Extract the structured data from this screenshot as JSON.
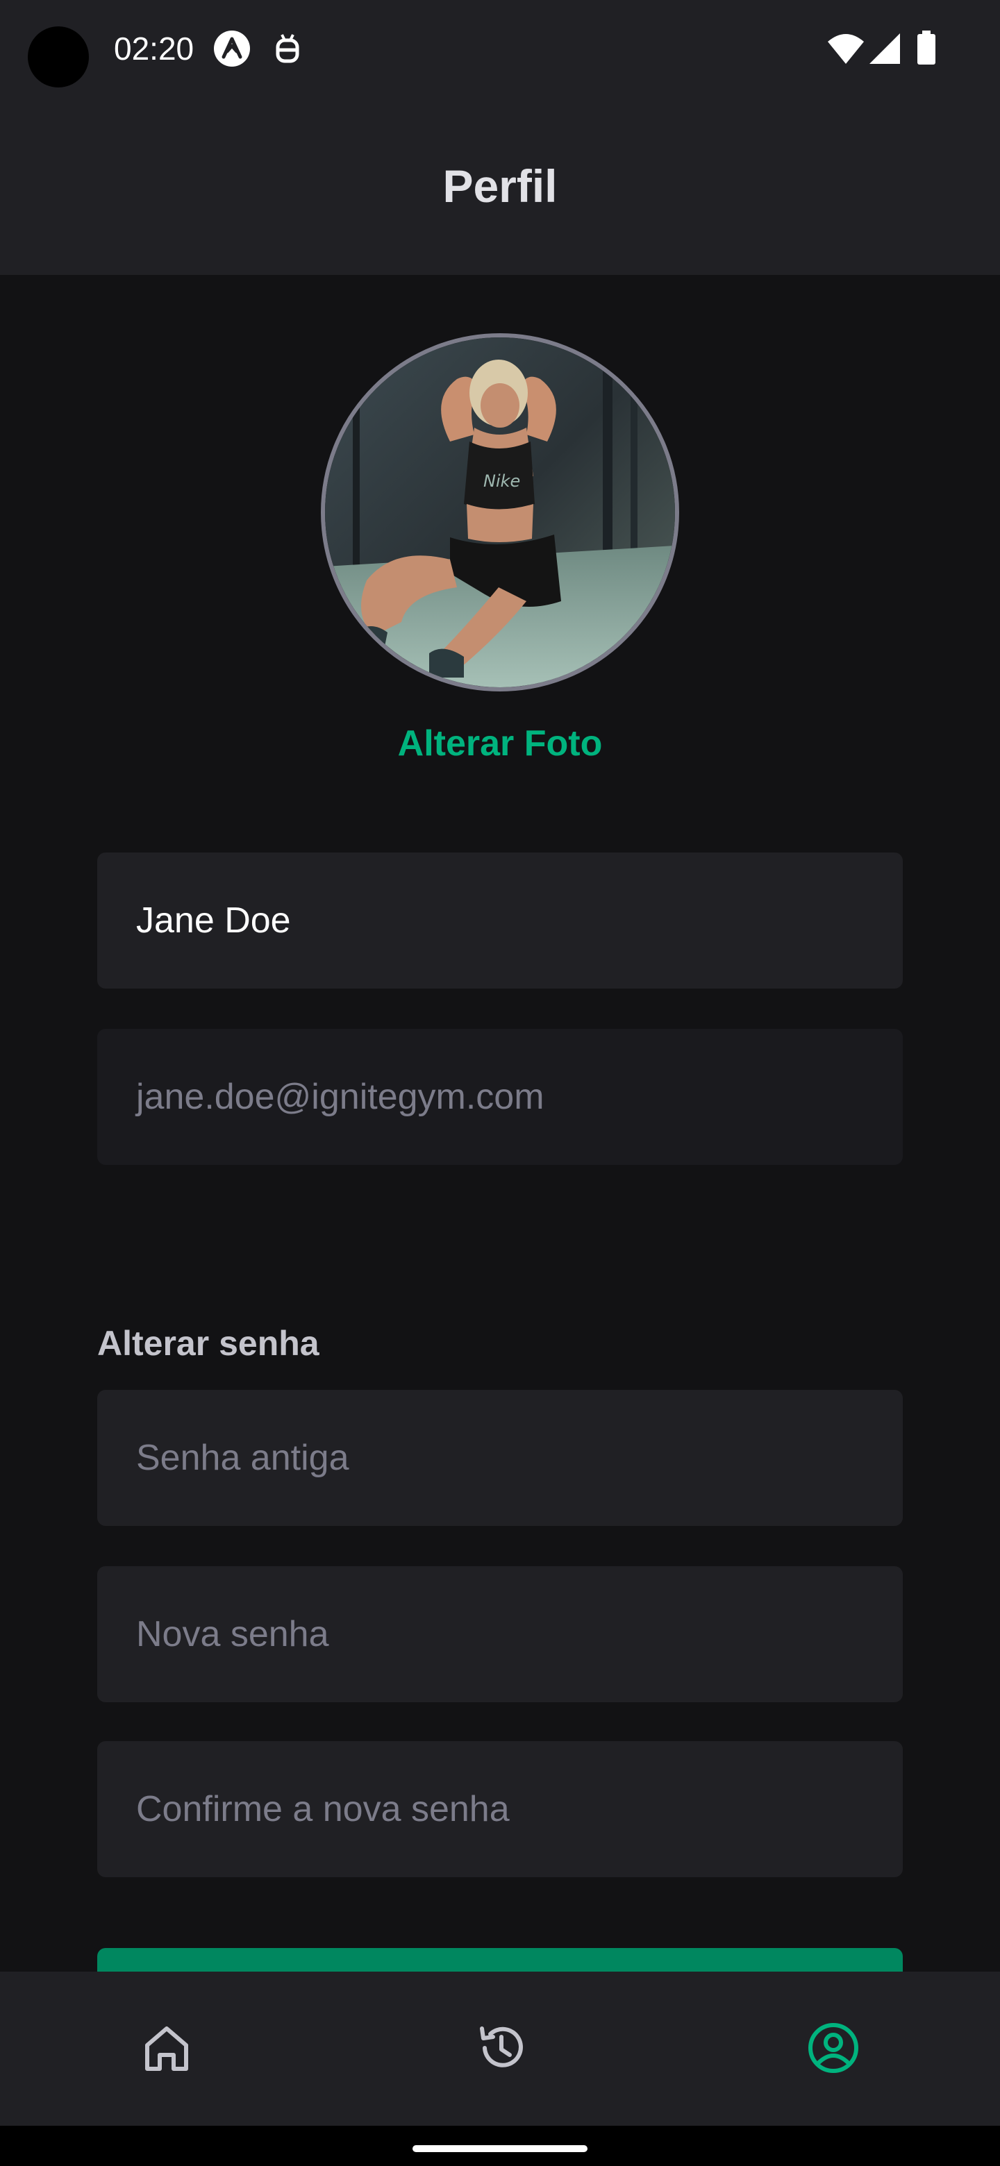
{
  "status_bar": {
    "time": "02:20"
  },
  "header": {
    "title": "Perfil"
  },
  "profile": {
    "change_photo_label": "Alterar Foto",
    "name_value": "Jane Doe",
    "email_value": "jane.doe@ignitegym.com"
  },
  "password_section": {
    "title": "Alterar senha",
    "old_password_placeholder": "Senha antiga",
    "new_password_placeholder": "Nova senha",
    "confirm_password_placeholder": "Confirme a nova senha"
  },
  "tab_bar": {
    "items": [
      {
        "icon": "home-icon",
        "active": false
      },
      {
        "icon": "history-icon",
        "active": false
      },
      {
        "icon": "profile-icon",
        "active": true
      }
    ],
    "active_color": "#00B37E",
    "inactive_color": "#C4C4CC"
  },
  "colors": {
    "brand_green": "#00B37E",
    "button_green": "#00875F",
    "background": "#121214",
    "surface": "#202024"
  }
}
